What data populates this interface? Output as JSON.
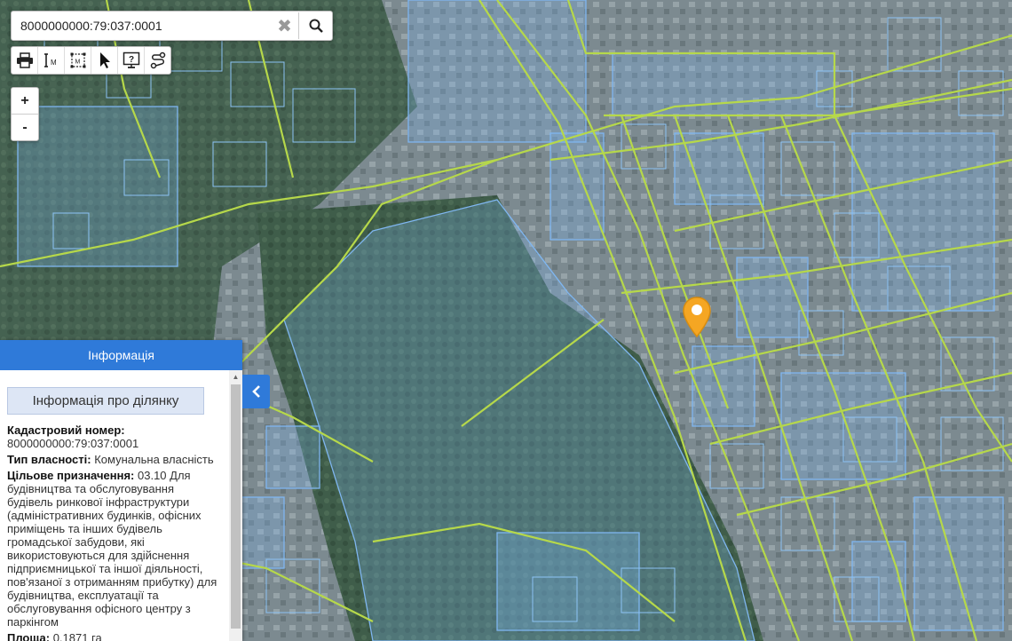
{
  "search": {
    "value": "8000000000:79:037:0001",
    "clear_icon": "close-icon",
    "search_icon": "search-icon"
  },
  "toolbar": {
    "tools": [
      "print-icon",
      "measure-distance-icon",
      "measure-area-icon",
      "select-pointer-icon",
      "info-help-icon",
      "route-icon"
    ]
  },
  "zoom": {
    "in_label": "+",
    "out_label": "-"
  },
  "panel": {
    "header": "Інформація",
    "section_title": "Інформація про ділянку",
    "cadastral_label": "Кадастровий номер:",
    "cadastral_value": "8000000000:79:037:0001",
    "ownership_label": "Тип власності:",
    "ownership_value": "Комунальна власність",
    "purpose_label": "Цільове призначення:",
    "purpose_value": "03.10 Для будівництва та обслуговування будівель ринкової інфраструктури (адміністративних будинків, офісних приміщень та інших будівель громадської забудови, які використовуються для здійснення підприємницької та іншої діяльності, пов'язаної з отриманням прибутку) для будівництва, експлуатації та обслуговування офісного центру з паркінгом",
    "area_label": "Площа:",
    "area_value": "0.1871 га"
  },
  "colors": {
    "accent": "#2f7ad9",
    "marker": "#f5a623",
    "parcel": "#7fb6f0",
    "road": "#b6d84a"
  }
}
